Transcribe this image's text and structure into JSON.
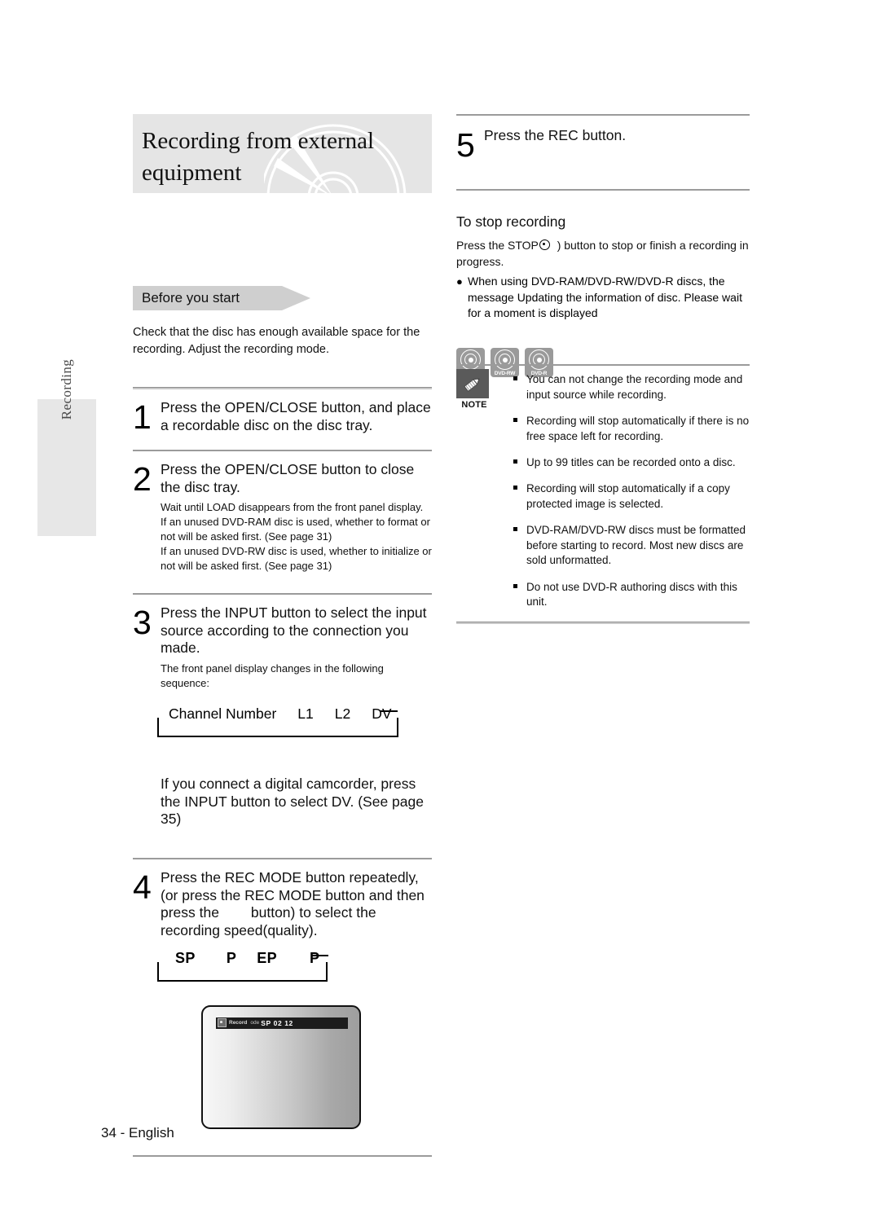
{
  "chapter_tab": {
    "label": "Recording"
  },
  "header": {
    "title": "Recording from external equipment",
    "disc_badges": [
      {
        "name": "DVD-RAM"
      },
      {
        "name": "DVD-RW"
      },
      {
        "name": "DVD-R"
      }
    ]
  },
  "before_you_start": {
    "banner_label": "Before you start",
    "text": "Check that the disc has enough available space for the recording. Adjust the recording mode."
  },
  "steps": [
    {
      "number": "1",
      "head": "Press the OPEN/CLOSE button, and place a recordable disc on the disc tray."
    },
    {
      "number": "2",
      "head": "Press the OPEN/CLOSE button to close the disc tray.",
      "sub": "Wait until  LOAD  disappears from the front panel display.\nIf an unused DVD-RAM disc is used, whether to format or not will be asked first. (See page 31)\nIf an unused DVD-RW disc is used, whether to initialize or not will be asked first. (See page 31)"
    },
    {
      "number": "3",
      "head": "Press the INPUT button to select the input source according to the connection you made.",
      "sub": "The front panel display changes in the following sequence:"
    },
    {
      "number": "4",
      "head": "Press the REC MODE button repeatedly, (or press the REC MODE button and then press the        button) to select the recording speed(quality)."
    },
    {
      "number": "5",
      "head": "Press the REC button."
    }
  ],
  "input_sequence": {
    "items": [
      "Channel Number",
      "L1",
      "L2",
      "DV"
    ]
  },
  "camcorder_note": "If you connect a digital camcorder, press the INPUT button to select DV. (See page 35)",
  "rec_mode_sequence": {
    "items": [
      "SP",
      "P",
      "EP",
      "P"
    ]
  },
  "tv_screen": {
    "osd_icon": "record-dot-icon",
    "osd_label": "Record",
    "osd_mode": "ode",
    "osd_value": "SP  02 12"
  },
  "stop_recording": {
    "heading": "To stop recording",
    "intro_before_glyph": "Press the STOP",
    "intro_after_glyph": ")  button to stop or finish a recording in progress.",
    "bullets": [
      "When using DVD-RAM/DVD-RW/DVD-R discs, the message  Updating the information of disc. Please wait for a moment  is displayed"
    ]
  },
  "note_box": {
    "label": "NOTE",
    "icon": "pencil-icon",
    "items": [
      "You can not change the recording mode and input source while recording.",
      "Recording will stop automatically if there is no free space left for recording.",
      "Up to 99 titles can be recorded onto a disc.",
      "Recording will stop automatically if a copy protected image is selected.",
      "DVD-RAM/DVD-RW discs must be formatted before starting to record. Most new discs are sold unformatted.",
      "Do not use DVD-R authoring discs with this unit."
    ]
  },
  "footer": {
    "page": "34 - English"
  }
}
